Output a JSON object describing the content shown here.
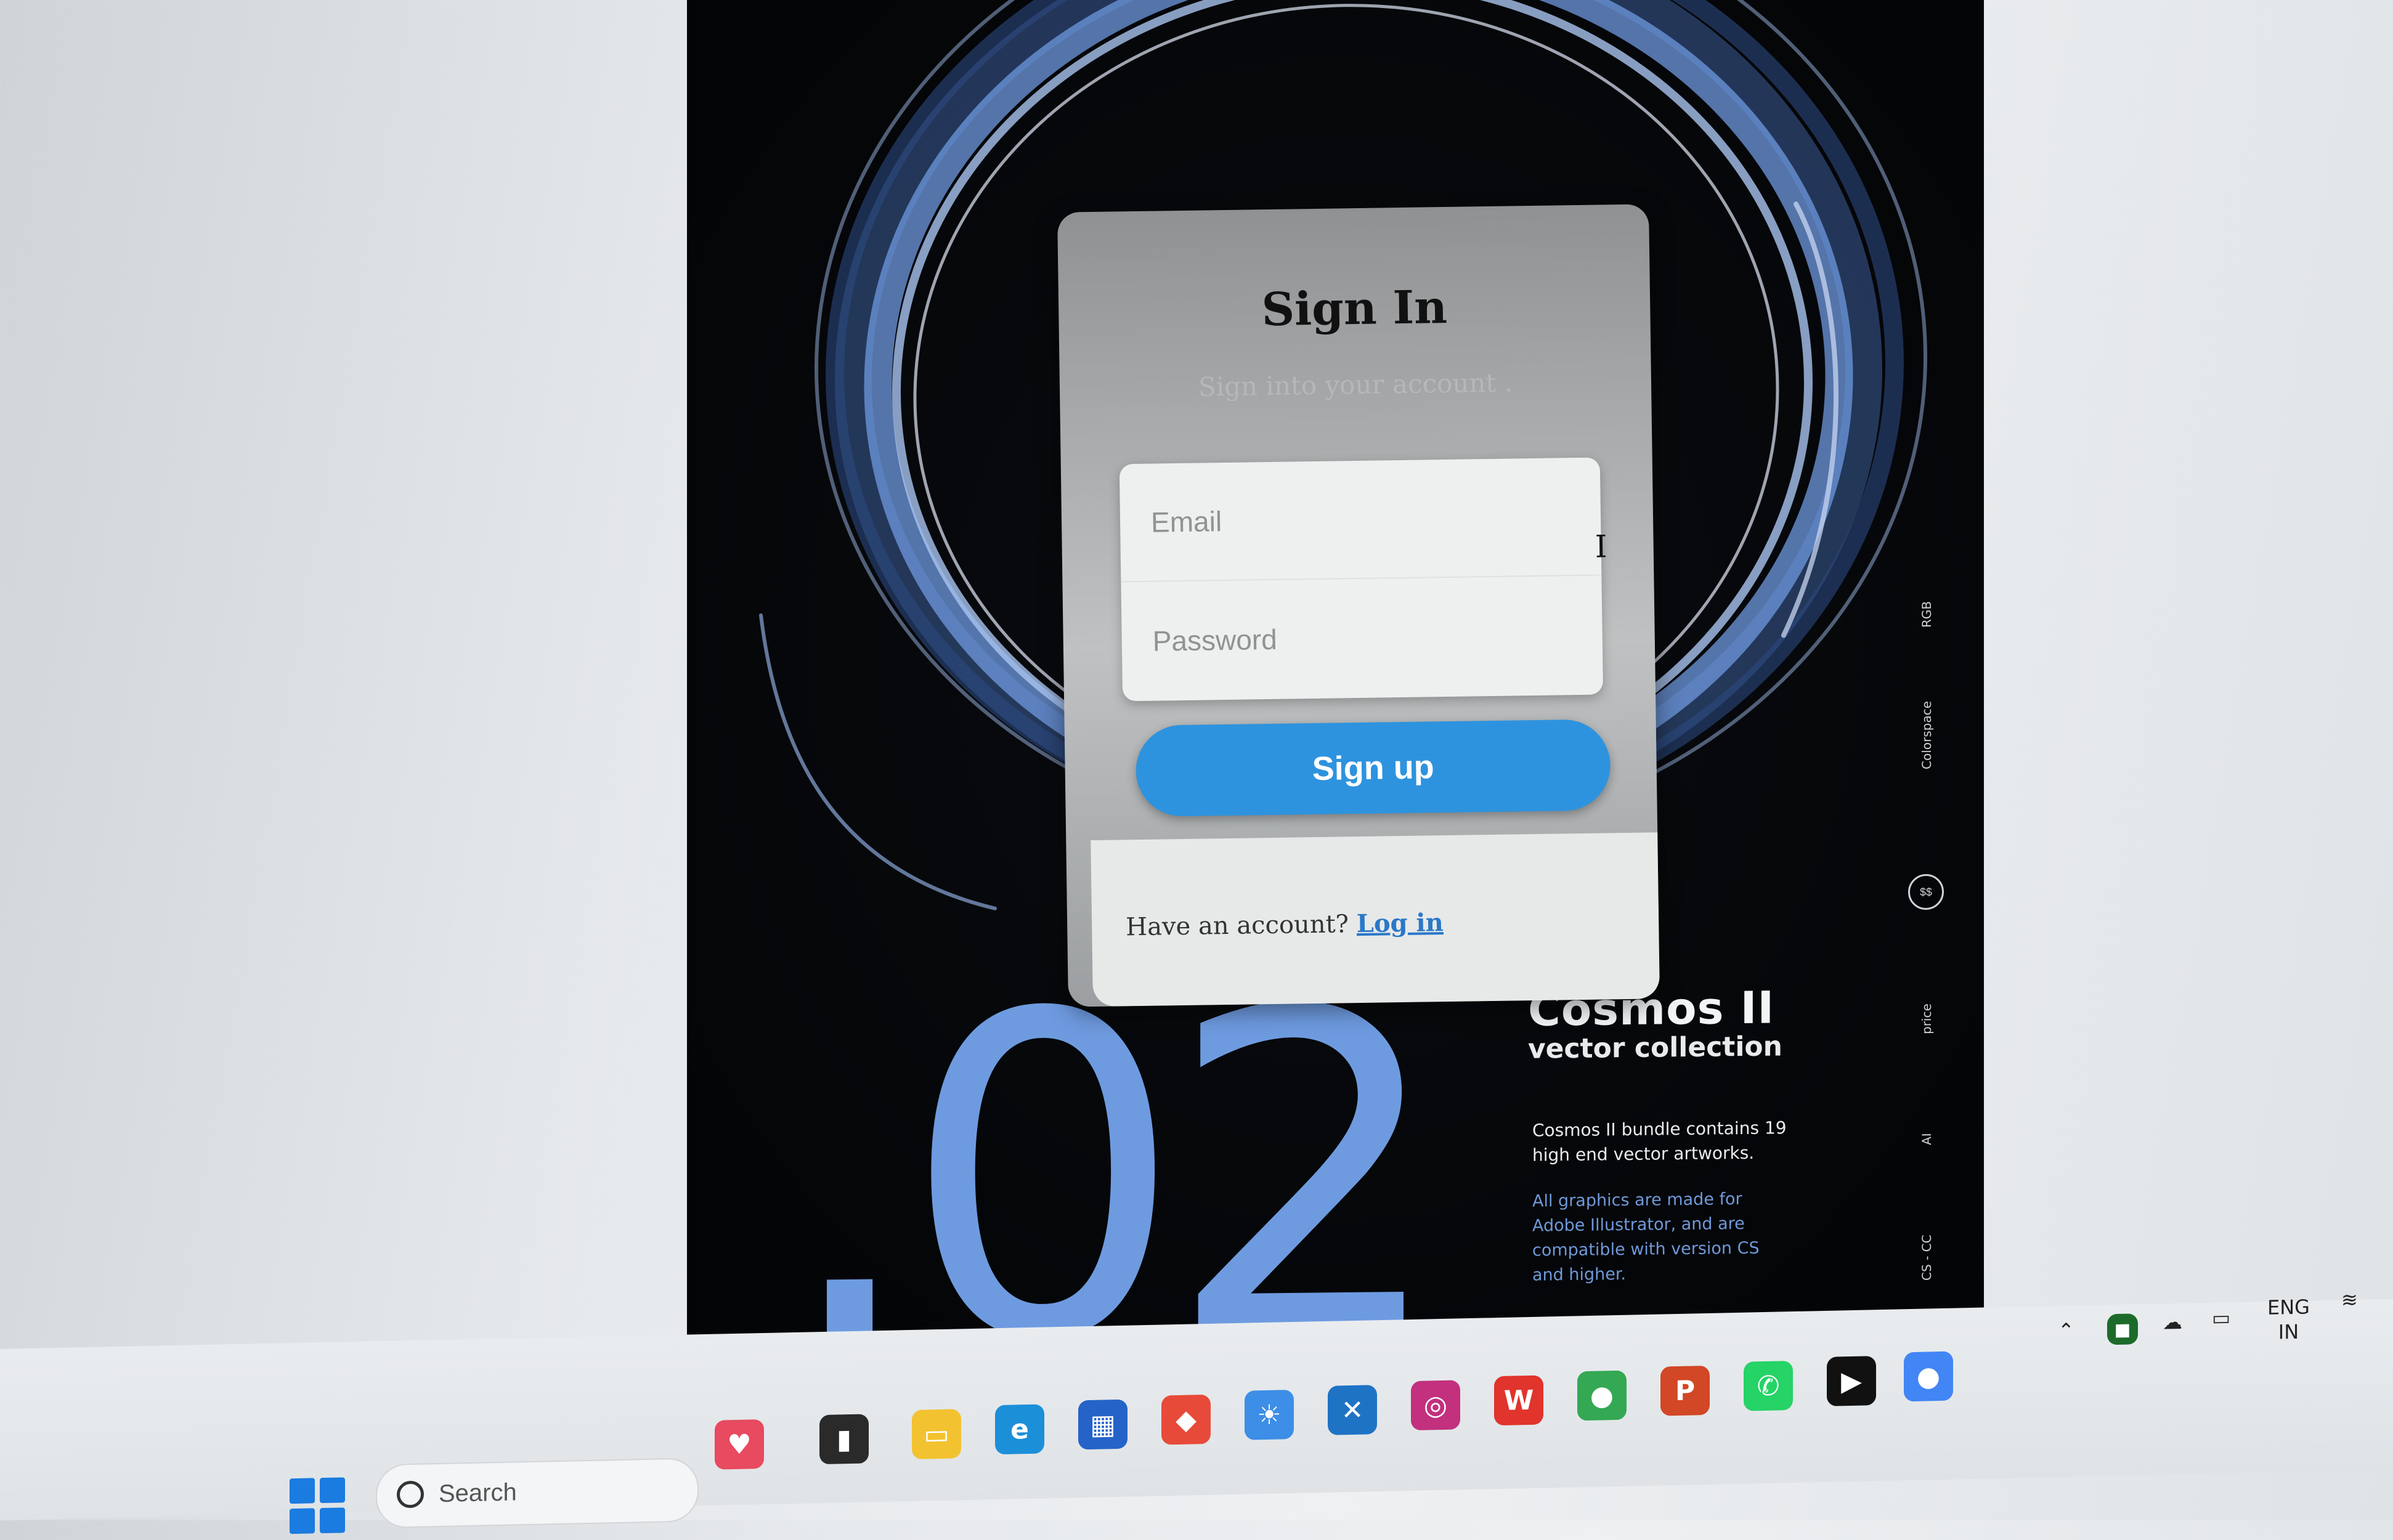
{
  "signin": {
    "title": "Sign In",
    "subtitle": "Sign into your account .",
    "email_placeholder": "Email",
    "password_placeholder": "Password",
    "signup_label": "Sign up",
    "footer_prompt": "Have an account?",
    "login_link": "Log in"
  },
  "poster": {
    "title": "Cosmos II",
    "subtitle": "vector collection",
    "description": "Cosmos II bundle contains 19 high end vector artworks.",
    "note": "All graphics are made for Adobe Illustrator, and are compatible with version CS and higher.",
    "big_number": ".02",
    "side_labels": [
      "RGB",
      "Colorspace",
      "price",
      "AI",
      "CS - CC"
    ],
    "side_badge": "$$"
  },
  "taskbar": {
    "search_placeholder": "Search",
    "apps": [
      "health-app",
      "task-view",
      "file-explorer",
      "edge",
      "store",
      "diamond-app",
      "weather-app",
      "vscode",
      "instagram",
      "wps-office",
      "chrome",
      "powerpoint",
      "whatsapp",
      "media-player",
      "chrome-alt"
    ],
    "language": "ENG",
    "region": "IN"
  },
  "colors": {
    "accent": "#2e93de",
    "poster_blue": "#6e9be0",
    "card_bg": "#a6a8aa"
  }
}
